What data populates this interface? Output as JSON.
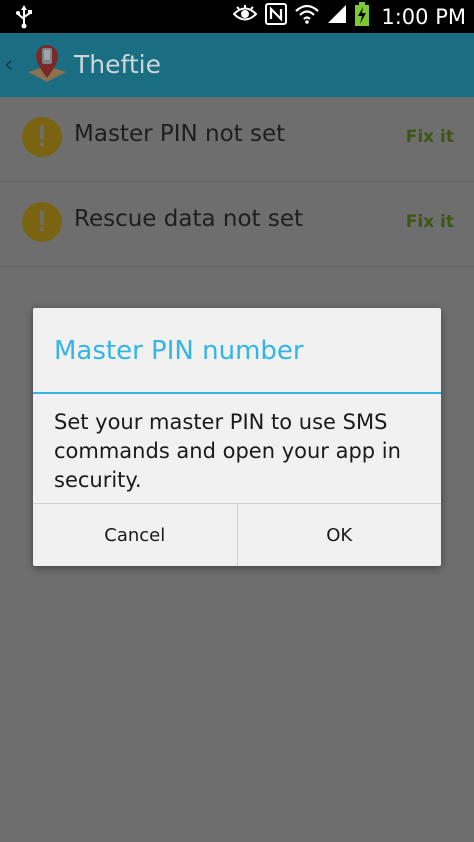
{
  "status_bar": {
    "time": "1:00 PM",
    "icons": [
      "usb-icon",
      "eye-icon",
      "nfc-icon",
      "wifi-icon",
      "signal-icon",
      "battery-charging-icon"
    ]
  },
  "action_bar": {
    "title": "Theftie",
    "back_glyph": "‹"
  },
  "list": {
    "items": [
      {
        "text": "Master PIN not set",
        "action": "Fix it",
        "icon": "warning-icon"
      },
      {
        "text": "Rescue data not set",
        "action": "Fix it",
        "icon": "warning-icon"
      }
    ]
  },
  "dialog": {
    "title": "Master PIN number",
    "message": "Set your master PIN to use SMS commands and open your app in security.",
    "cancel_label": "Cancel",
    "ok_label": "OK"
  },
  "colors": {
    "accent": "#33b5e5",
    "action_bar": "#1b6d82",
    "dim_overlay": "#6e6e6e",
    "fix_it": "#3e5614",
    "warning": "#7a6412"
  }
}
